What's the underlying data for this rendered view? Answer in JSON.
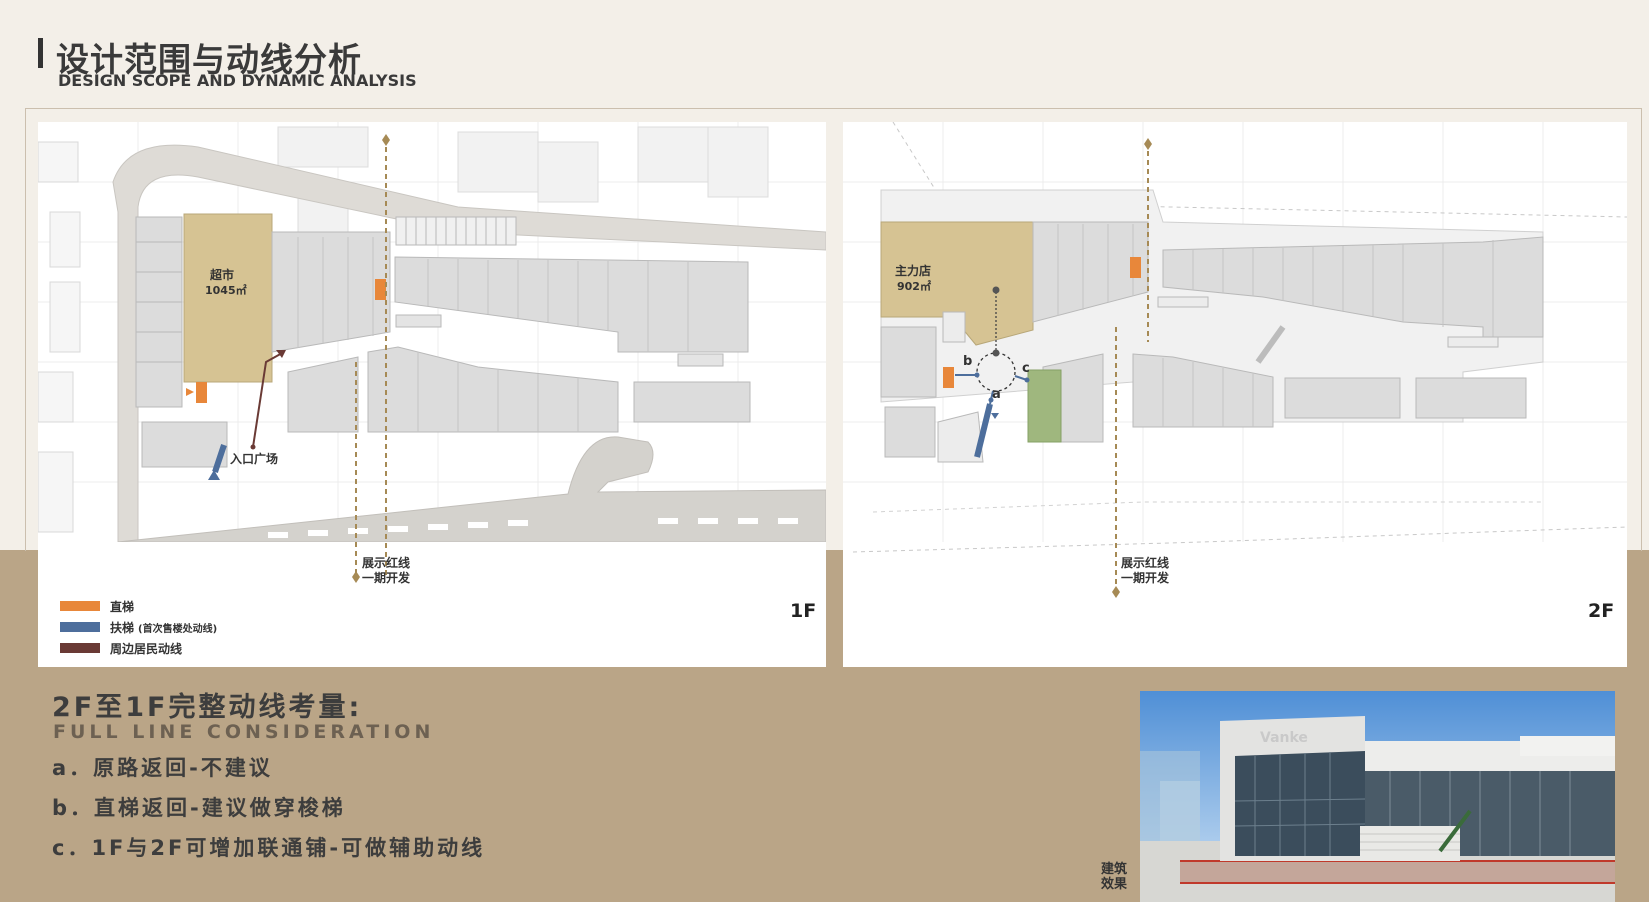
{
  "header": {
    "title_zh": "设计范围与动线分析",
    "title_en": "DESIGN SCOPE AND DYNAMIC ANALYSIS"
  },
  "floor1": {
    "floor_label": "1F",
    "supermarket_name": "超市",
    "supermarket_area": "1045㎡",
    "entrance_label": "入口广场",
    "redline_line1": "展示红线",
    "redline_line2": "一期开发"
  },
  "floor2": {
    "floor_label": "2F",
    "anchor_name": "主力店",
    "anchor_area": "902㎡",
    "point_a": "a",
    "point_b": "b",
    "point_c": "c",
    "redline_line1": "展示红线",
    "redline_line2": "一期开发"
  },
  "legend": [
    {
      "label": "直梯",
      "note": "",
      "color": "#e8873a"
    },
    {
      "label": "扶梯",
      "note": "(首次售楼处动线)",
      "color": "#4d6e9c"
    },
    {
      "label": "周边居民动线",
      "note": "",
      "color": "#6a3a35"
    }
  ],
  "analysis": {
    "heading_zh": "2F至1F完整动线考量:",
    "heading_en": "FULL LINE CONSIDERATION",
    "options": [
      "a．原路返回-不建议",
      "b．直梯返回-建议做穿梭梯",
      "c．1F与2F可增加联通铺-可做辅助动线"
    ]
  },
  "render": {
    "caption": "建筑效果",
    "logo_text": "Vanke"
  },
  "colors": {
    "elevator": "#e8873a",
    "escalator": "#4d6e9c",
    "resident_flow": "#6a3a35",
    "anchor_store": "#d6c393",
    "redline": "#a68a55",
    "green_area": "#9fb77e"
  }
}
